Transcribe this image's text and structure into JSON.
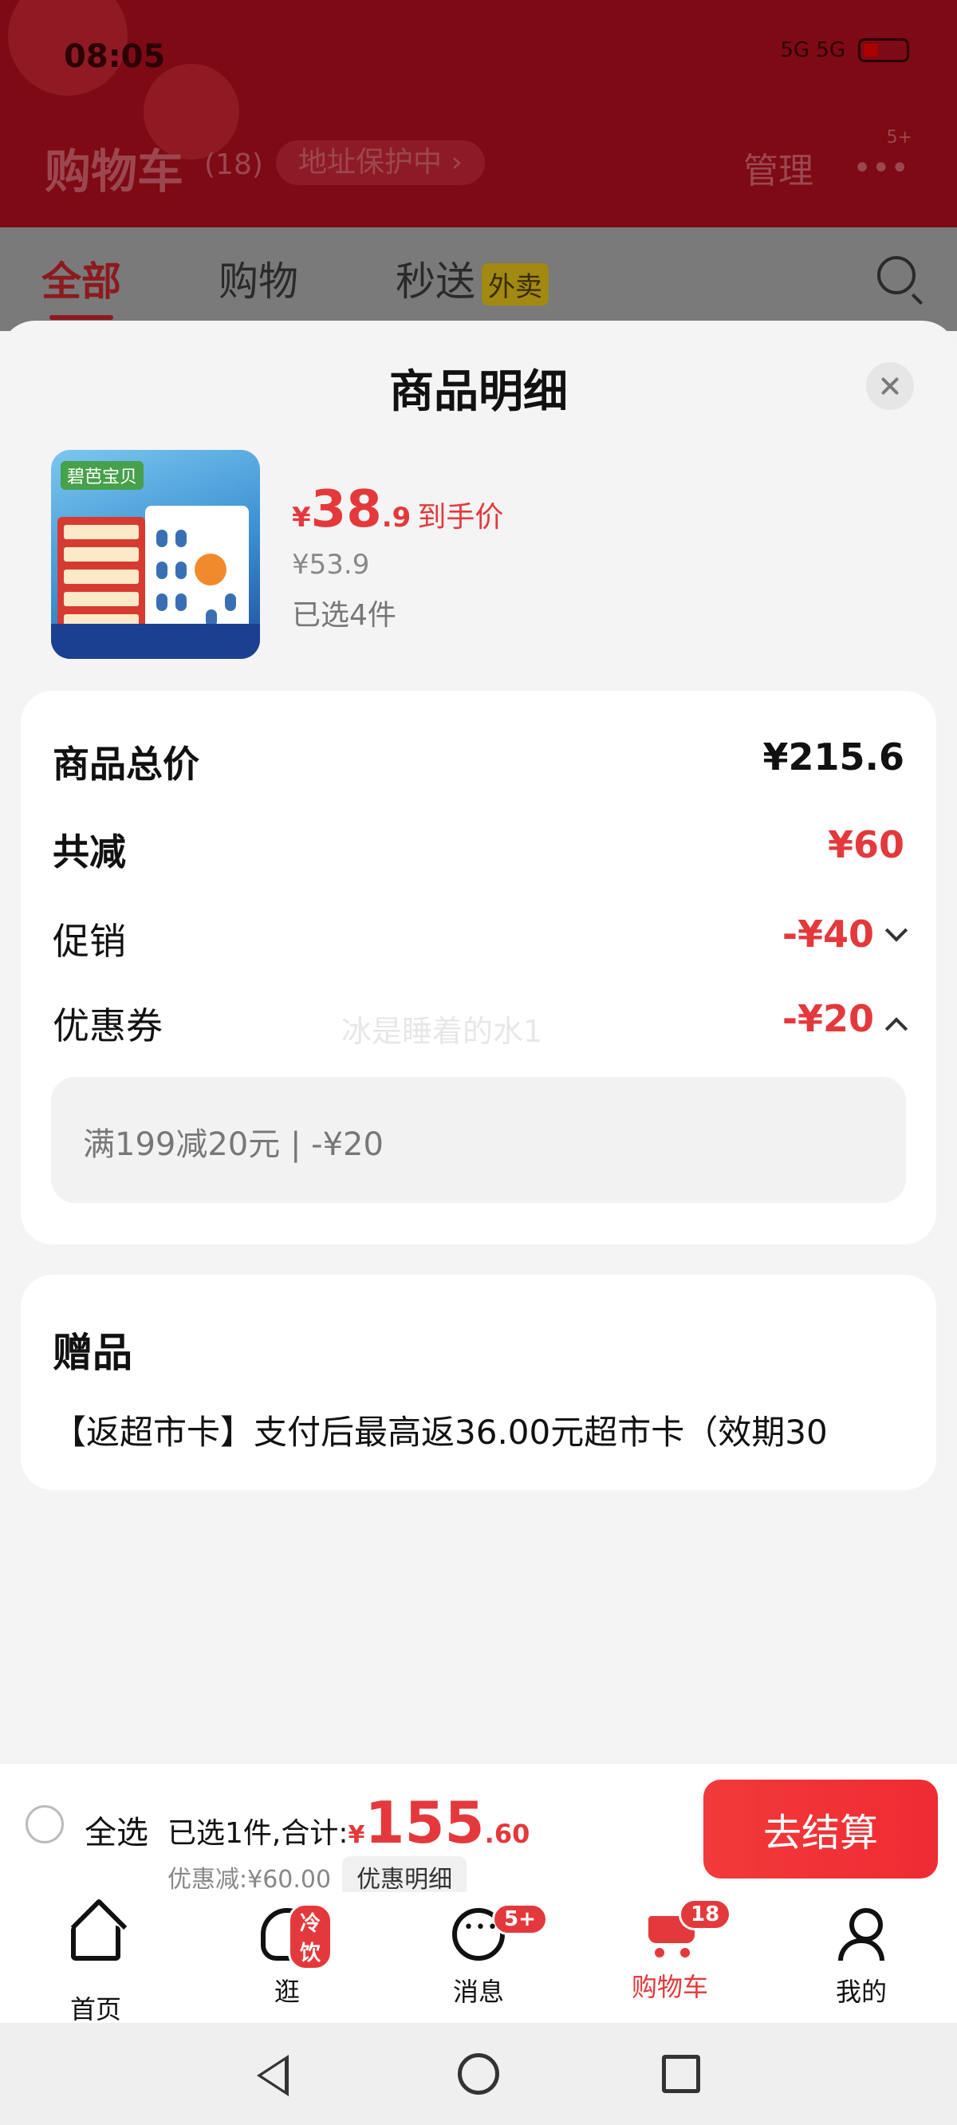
{
  "status_bar": {
    "time": "08:05",
    "network": "5G 5G"
  },
  "header": {
    "title": "购物车",
    "count": "(18)",
    "address_protect": "地址保护中",
    "manage": "管理",
    "more_badge": "5+"
  },
  "tabs": [
    {
      "label": "全部"
    },
    {
      "label": "购物"
    },
    {
      "label": "秒送",
      "tag": "外卖"
    }
  ],
  "sheet": {
    "title": "商品明细",
    "product": {
      "price_currency": "¥",
      "price_int": "38",
      "price_dec": ".9",
      "price_label": "到手价",
      "original_price": "¥53.9",
      "selected": "已选4件",
      "image_logo": "碧芭宝贝"
    },
    "breakdown": {
      "total_label": "商品总价",
      "total_value": "¥215.6",
      "reduce_label": "共减",
      "reduce_value": "¥60",
      "promo_label": "促销",
      "promo_value": "-¥40",
      "coupon_label": "优惠券",
      "coupon_value": "-¥20",
      "coupon_detail": "满199减20元 | -¥20",
      "watermark": "冰是睡着的水1"
    },
    "gift": {
      "title": "赠品",
      "text": "【返超市卡】支付后最高返36.00元超市卡（效期30"
    }
  },
  "checkout": {
    "select_all": "全选",
    "summary_prefix": "已选1件,合计:",
    "amount_currency": "¥",
    "amount_int": "155",
    "amount_dec": ".60",
    "discount_text": "优惠减:¥60.00",
    "detail_chip": "优惠明细",
    "pay_button": "去结算"
  },
  "tabbar": [
    {
      "label": "首页",
      "icon": "home-icon"
    },
    {
      "label": "逛",
      "icon": "stroll-icon",
      "badge": "冷饮"
    },
    {
      "label": "消息",
      "icon": "message-icon",
      "badge": "5+"
    },
    {
      "label": "购物车",
      "icon": "cart-icon",
      "badge": "18",
      "active": true
    },
    {
      "label": "我的",
      "icon": "profile-icon"
    }
  ],
  "colors": {
    "accent": "#e4393c",
    "header_dim": "#7d0a14"
  }
}
